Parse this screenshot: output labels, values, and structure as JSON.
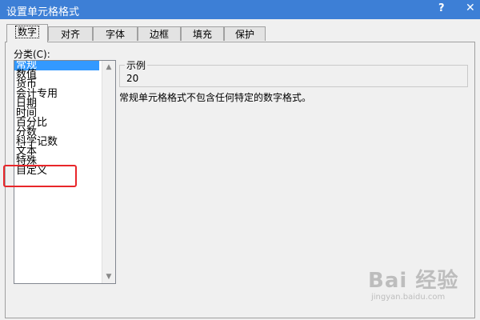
{
  "window": {
    "title": "设置单元格格式",
    "help_label": "?",
    "close_label": "✕"
  },
  "tabs": [
    {
      "label": "数字",
      "active": true
    },
    {
      "label": "对齐",
      "active": false
    },
    {
      "label": "字体",
      "active": false
    },
    {
      "label": "边框",
      "active": false
    },
    {
      "label": "填充",
      "active": false
    },
    {
      "label": "保护",
      "active": false
    }
  ],
  "category": {
    "label": "分类(C):",
    "items": [
      "常规",
      "数值",
      "货币",
      "会计专用",
      "日期",
      "时间",
      "百分比",
      "分数",
      "科学记数",
      "文本",
      "特殊",
      "自定义"
    ],
    "selected": "常规"
  },
  "sample": {
    "legend": "示例",
    "value": "20"
  },
  "description": "常规单元格格式不包含任何特定的数字格式。",
  "watermark": {
    "main": "Bai 经验",
    "url": "jingyan.baidu.com"
  },
  "colors": {
    "titlebar": "#3d7fd6",
    "selection": "#3399ff",
    "highlight_box": "#e8262a"
  }
}
